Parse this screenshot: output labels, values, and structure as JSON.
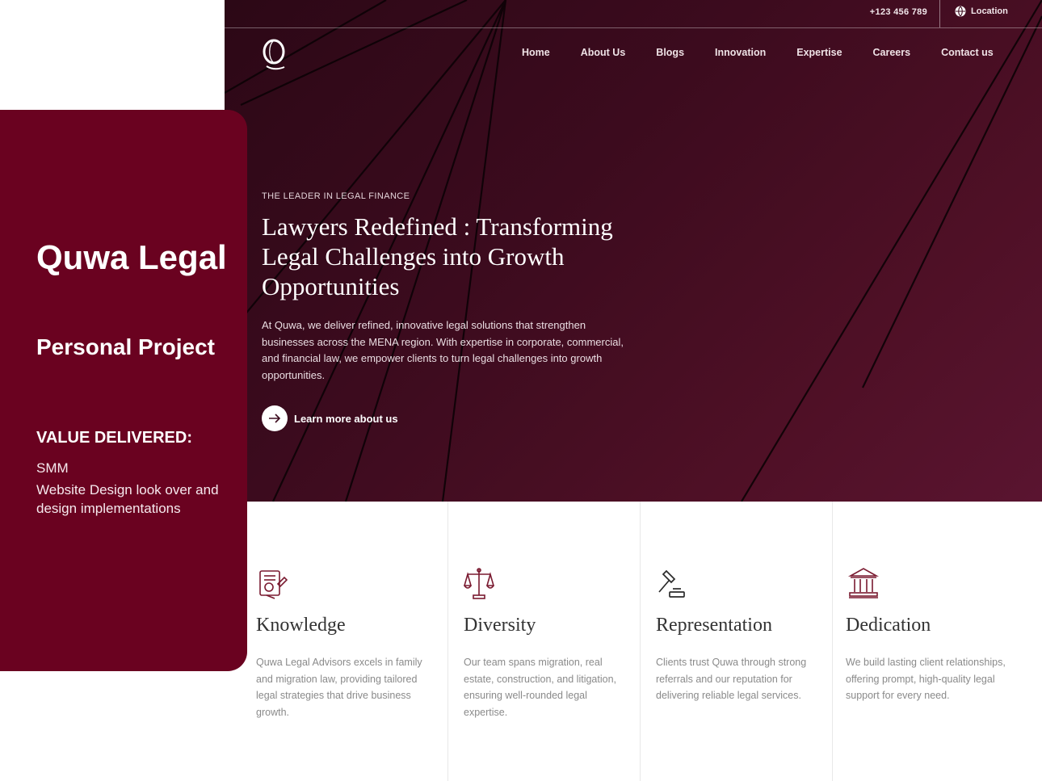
{
  "panel": {
    "title": "Quwa Legal",
    "subtitle": "Personal Project",
    "value_heading": "VALUE DELIVERED:",
    "values": [
      "SMM",
      "Website Design look over and design implementations"
    ]
  },
  "topbar": {
    "phone": "+123 456 789",
    "location": "Location"
  },
  "nav": {
    "items": [
      "Home",
      "About Us",
      "Blogs",
      "Innovation",
      "Expertise",
      "Careers",
      "Contact us"
    ]
  },
  "hero": {
    "eyebrow": "THE LEADER IN LEGAL FINANCE",
    "title": "Lawyers Redefined : Transforming Legal Challenges into Growth Opportunities",
    "description": "At Quwa, we deliver refined, innovative legal solutions that strengthen businesses across the MENA region. With expertise in corporate, commercial, and financial law, we empower clients to turn legal challenges into growth opportunities.",
    "cta": "Learn more about us"
  },
  "features": [
    {
      "icon": "document-icon",
      "title": "Knowledge",
      "description": "Quwa Legal Advisors excels in family and migration law, providing tailored legal strategies that drive business growth."
    },
    {
      "icon": "scales-icon",
      "title": "Diversity",
      "description": "Our team spans migration, real estate, construction, and litigation, ensuring well-rounded legal expertise."
    },
    {
      "icon": "gavel-icon",
      "title": "Representation",
      "description": "Clients trust Quwa through strong referrals and our reputation for delivering reliable legal services."
    },
    {
      "icon": "courthouse-icon",
      "title": "Dedication",
      "description": "We build lasting client relationships, offering prompt, high-quality legal support for every need."
    }
  ],
  "colors": {
    "brand": "#6a0220",
    "hero_dark": "#2c0816",
    "hero_light": "#5a1430",
    "icon": "#7a1a30"
  }
}
